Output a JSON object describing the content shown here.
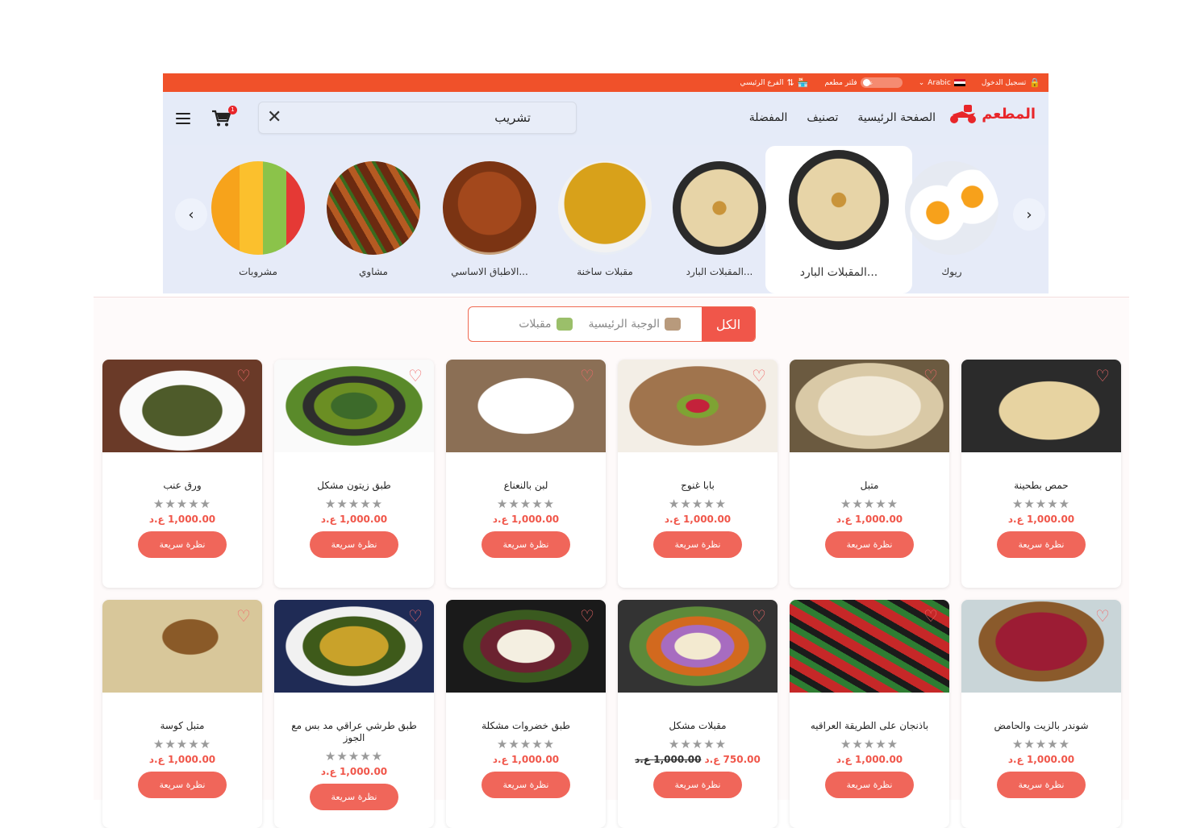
{
  "topbar": {
    "login": "تسجيل الدخول",
    "language": "Arabic",
    "toggle_state": "عن",
    "filter_label": "فلتر مطعم",
    "branch_label": "الفرع الرئيسي"
  },
  "header": {
    "logo_text": "المطعم",
    "nav": [
      "الصفحة الرئيسية",
      "تصنيف",
      "المفضلة"
    ],
    "search_value": "تشريب",
    "cart_count": "1"
  },
  "categories": [
    {
      "label": "ريوك",
      "image": "fried-eggs"
    },
    {
      "label": "المقبلات البارد...",
      "image": "hummus",
      "active": true
    },
    {
      "label": "المقبلات البارد...",
      "image": "hummus"
    },
    {
      "label": "مقبلات ساخنة",
      "image": "chickpea-soup"
    },
    {
      "label": "الاطباق الاساسي...",
      "image": "roast-chicken"
    },
    {
      "label": "مشاوي",
      "image": "kebab"
    },
    {
      "label": "مشروبات",
      "image": "juices"
    }
  ],
  "filter_tabs": {
    "all": "الكل",
    "main_meal": "الوجبة الرئيسية",
    "starters": "مقبلات"
  },
  "products": [
    {
      "name": "حمص بطحينة",
      "price": "1,000.00 ع.د",
      "button": "نظرة سريعة",
      "image": "hummus"
    },
    {
      "name": "متبل",
      "price": "1,000.00 ع.د",
      "button": "نظرة سريعة",
      "image": "mutabal"
    },
    {
      "name": "بابا غنوج",
      "price": "1,000.00 ع.د",
      "button": "نظرة سريعة",
      "image": "baba-ghanoush"
    },
    {
      "name": "لبن بالنعناع",
      "price": "1,000.00 ع.د",
      "button": "نظرة سريعة",
      "image": "yogurt-mint"
    },
    {
      "name": "طبق زيتون مشكل",
      "price": "1,000.00 ع.د",
      "button": "نظرة سريعة",
      "image": "olives"
    },
    {
      "name": "ورق عنب",
      "price": "1,000.00 ع.د",
      "button": "نظرة سريعة",
      "image": "grape-leaves"
    },
    {
      "name": "شوندر بالزيت والحامض",
      "price": "1,000.00 ع.د",
      "button": "نظرة سريعة",
      "image": "beet-salad"
    },
    {
      "name": "باذنجان على الطريقة العراقيه",
      "price": "1,000.00 ع.د",
      "button": "نظرة سريعة",
      "image": "eggplant"
    },
    {
      "name": "مقبلات مشكل",
      "price": "750.00 ع.د",
      "old_price": "1,000.00 ع.د",
      "button": "نظرة سريعة",
      "image": "mixed-starters"
    },
    {
      "name": "طبق خضروات مشكلة",
      "price": "1,000.00 ع.د",
      "button": "نظرة سريعة",
      "image": "veg-platter"
    },
    {
      "name": "طبق طرشي عراقي مد بس مع الجوز",
      "price": "1,000.00 ع.د",
      "button": "نظرة سريعة",
      "image": "pickles"
    },
    {
      "name": "متبل كوسة",
      "price": "1,000.00 ع.د",
      "button": "نظرة سريعة",
      "image": "zucchini-mutabal"
    }
  ],
  "colors": {
    "brand": "#f0512a",
    "accent": "#f0564a",
    "header_bg": "#e5ebf8"
  }
}
